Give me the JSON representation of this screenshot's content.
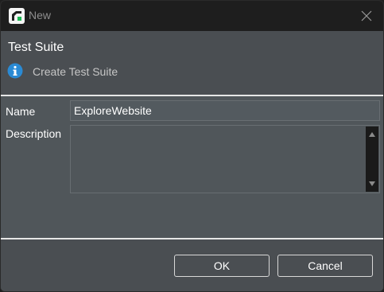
{
  "window": {
    "title": "New"
  },
  "header": {
    "title": "Test Suite",
    "subtitle": "Create Test Suite"
  },
  "form": {
    "name_label": "Name",
    "name_value": "ExploreWebsite",
    "description_label": "Description",
    "description_value": ""
  },
  "buttons": {
    "ok_label": "OK",
    "cancel_label": "Cancel"
  },
  "icons": {
    "app": "app-logo-icon",
    "close": "close-icon",
    "info": "info-icon",
    "scroll_up": "scroll-up-arrow-icon",
    "scroll_down": "scroll-down-arrow-icon"
  },
  "colors": {
    "info_icon": "#2a8ad4",
    "app_icon_accent": "#1db954"
  }
}
